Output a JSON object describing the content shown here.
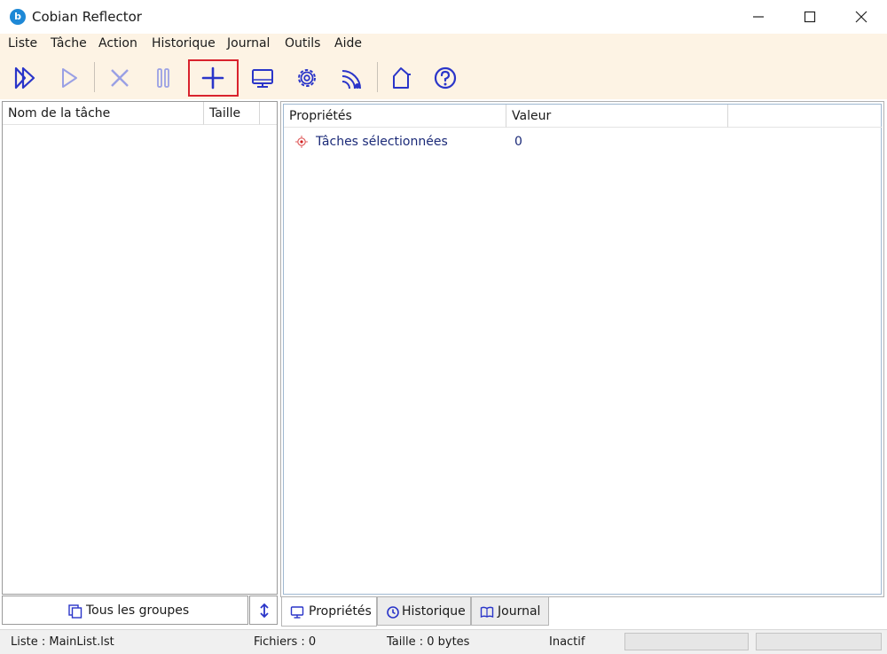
{
  "window": {
    "title": "Cobian Reflector",
    "icon_letter": "b"
  },
  "menu": [
    "Liste",
    "Tâche",
    "Action",
    "Historique",
    "Journal",
    "Outils",
    "Aide"
  ],
  "toolbar": {
    "icons": [
      "run-all-icon",
      "run-icon",
      "cancel-icon",
      "pause-icon",
      "add-task-icon",
      "display-icon",
      "settings-icon",
      "remote-icon",
      "home-icon",
      "help-icon"
    ],
    "highlighted": "add-task-icon",
    "accent_color": "#2a35c9",
    "disabled_color": "#9aa0e4"
  },
  "task_list": {
    "columns": [
      "Nom de la tâche",
      "Taille"
    ],
    "rows": []
  },
  "groups": {
    "label": "Tous les groupes"
  },
  "properties": {
    "columns": [
      "Propriétés",
      "Valeur"
    ],
    "rows": [
      {
        "name": "Tâches sélectionnées",
        "value": "0"
      }
    ]
  },
  "tabs": [
    {
      "label": "Propriétés",
      "active": true
    },
    {
      "label": "Historique",
      "active": false
    },
    {
      "label": "Journal",
      "active": false
    }
  ],
  "status": {
    "list": "Liste : MainList.lst",
    "files": "Fichiers : 0",
    "size": "Taille : 0 bytes",
    "state": "Inactif"
  }
}
